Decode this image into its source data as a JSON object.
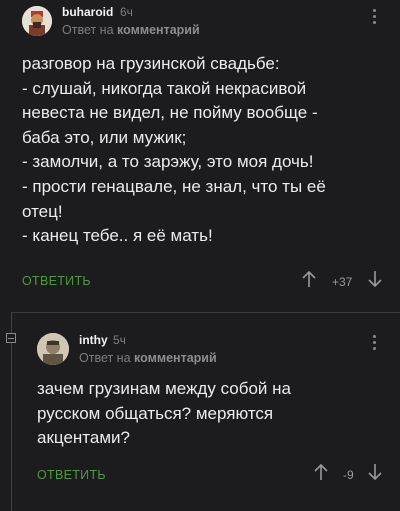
{
  "comments": [
    {
      "username": "buharoid",
      "time": "6ч",
      "reply_prefix": "Ответ на",
      "reply_target": "комментарий",
      "lines": [
        "разговор на грузинской свадьбе:",
        "- слушай, никогда такой некрасивой",
        "невеста не видел, не пойму вообще -",
        "баба это, или мужик;",
        "- замолчи, а то зарэжу, это моя дочь!",
        "- прости генацвале, не знал, что ты её",
        "отец!",
        "- канец тебе.. я её мать!"
      ],
      "reply_label": "ОТВЕТИТЬ",
      "score": "+37"
    },
    {
      "username": "inthy",
      "time": "5ч",
      "reply_prefix": "Ответ на",
      "reply_target": "комментарий",
      "lines": [
        "зачем грузинам между собой на",
        "русском общаться? меряются",
        "акцентами?"
      ],
      "reply_label": "ОТВЕТИТЬ",
      "score": "-9"
    }
  ],
  "icons": {
    "up": "arrow-up-icon",
    "down": "arrow-down-icon",
    "menu": "more-vertical-icon"
  },
  "colors": {
    "background": "#1c1c1e",
    "reply_green": "#4d9a3e",
    "muted": "#7d7d80"
  }
}
